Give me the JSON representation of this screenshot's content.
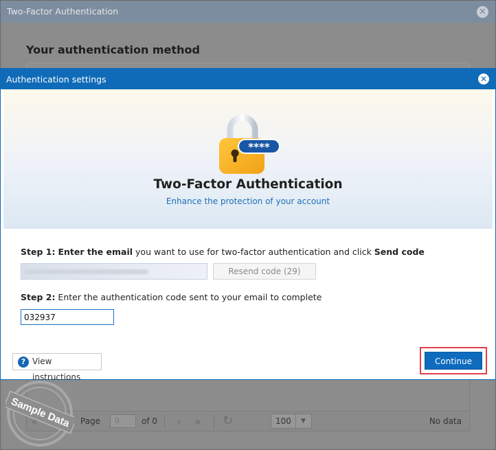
{
  "outer_window": {
    "title": "Two-Factor Authentication",
    "heading": "Your authentication method",
    "pager": {
      "page_label": "Page",
      "page_value": "0",
      "of_label": "of 0",
      "page_size": "100",
      "no_data": "No data"
    }
  },
  "dialog": {
    "title": "Authentication settings",
    "hero": {
      "badge": "****",
      "title": "Two-Factor Authentication",
      "subtitle": "Enhance the protection of your account"
    },
    "step1": {
      "label": "Step 1:",
      "bold1": "Enter the email",
      "text": " you want to use for two-factor authentication and click ",
      "bold2": "Send code"
    },
    "email_input": {
      "value": ""
    },
    "resend_button": "Resend code (29)",
    "step2": {
      "label": "Step 2:",
      "text": " Enter the authentication code sent to your email to complete"
    },
    "code_input": {
      "value": "032937"
    },
    "instructions_button": "View instructions",
    "continue_button": "Continue"
  },
  "watermark": {
    "text": "Sample Data"
  },
  "colors": {
    "titlebar_blue": "#0f6bb8",
    "link_blue": "#1d6fb8",
    "highlight_red": "#e0404a"
  }
}
